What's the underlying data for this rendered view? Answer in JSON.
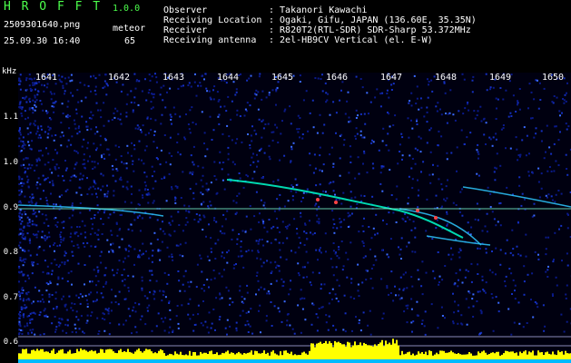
{
  "header": {
    "brand": "H R O F F T",
    "version": "1.0.0",
    "filename": "2509301640.png",
    "datetime": "25.09.30 16:40",
    "meteor_label": "meteor",
    "meteor_count": "65"
  },
  "info": [
    {
      "key": "Observer",
      "value": ": Takanori Kawachi"
    },
    {
      "key": "Receiving Location",
      "value": ": Ogaki, Gifu, JAPAN (136.60E, 35.35N)"
    },
    {
      "key": "Receiver",
      "value": ": R820T2(RTL-SDR) SDR-Sharp 53.372MHz"
    },
    {
      "key": "Receiving antenna",
      "value": ": 2el-HB9CV Vertical (el. E-W)"
    }
  ],
  "axis": {
    "unit": "kHz",
    "y_ticks": [
      "1.1",
      "1.0",
      "0.9",
      "0.8",
      "0.7",
      "0.6"
    ],
    "x_ticks": [
      "1641",
      "1642",
      "1643",
      "1644",
      "1645",
      "1646",
      "1647",
      "1648",
      "1649",
      "1650"
    ]
  },
  "colors": {
    "background": "#000000",
    "noise": "#0a1a8a",
    "trace": "#00ffcc",
    "hot": "#ff4444",
    "level_bar": "#ffff00",
    "level_base": "#00bbff",
    "label_green": "#4cff4c"
  }
}
